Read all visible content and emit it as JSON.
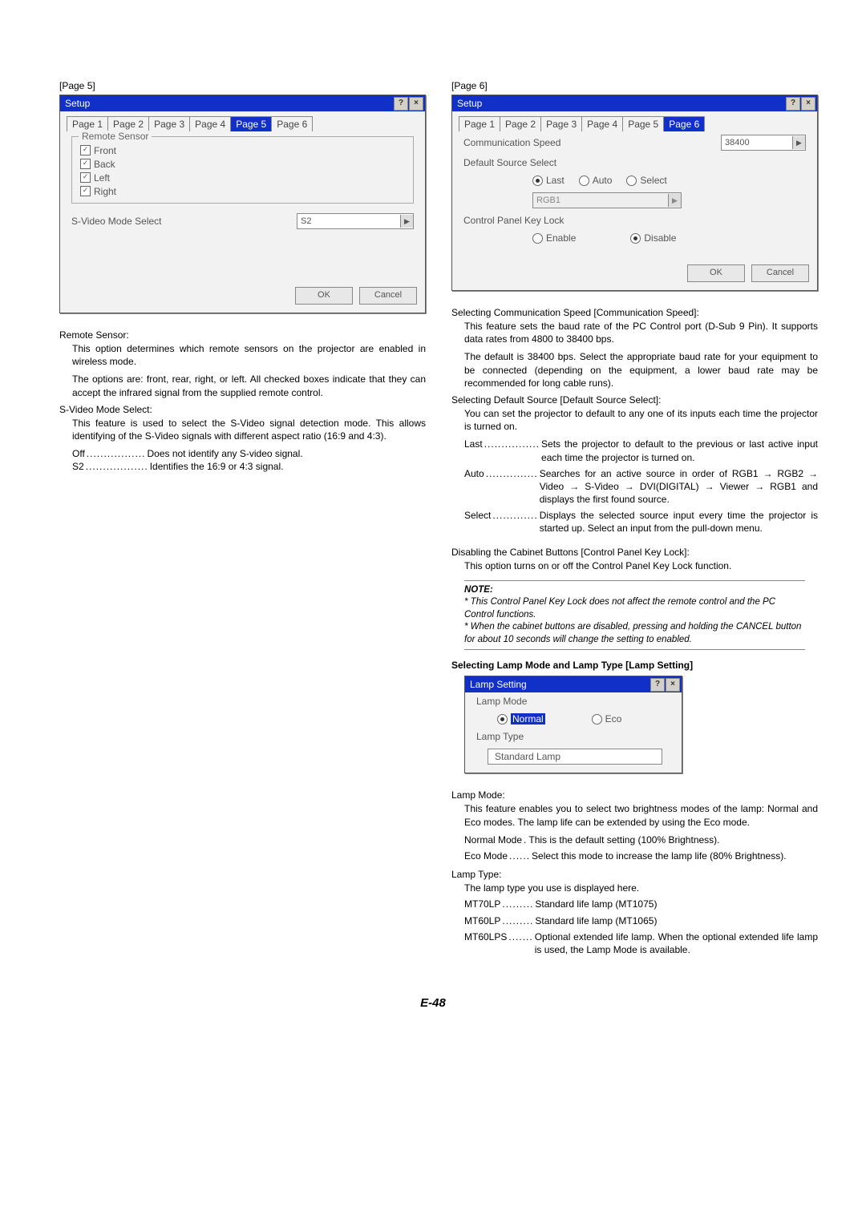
{
  "left": {
    "pageLabel": "[Page 5]",
    "dlg": {
      "title": "Setup",
      "tabs": [
        "Page 1",
        "Page 2",
        "Page 3",
        "Page 4",
        "Page 5",
        "Page 6"
      ],
      "activeTab": 4,
      "group": "Remote Sensor",
      "checks": [
        "Front",
        "Back",
        "Left",
        "Right"
      ],
      "svLabel": "S-Video Mode Select",
      "svValue": "S2",
      "ok": "OK",
      "cancel": "Cancel"
    },
    "remoteHead": "Remote Sensor:",
    "remoteP1": "This option determines which remote sensors on the projector are enabled in wireless mode.",
    "remoteP2": "The options are: front, rear, right, or left. All checked boxes indicate that they can accept the infrared signal from the supplied remote control.",
    "svHead": "S-Video Mode Select:",
    "svP1": "This feature is used to select the S-Video signal detection mode. This allows identifying of the S-Video signals with different aspect ratio (16:9 and 4:3).",
    "svDefs": [
      {
        "k": "Off",
        "dots": " .................",
        "v": "Does not identify any S-video signal."
      },
      {
        "k": "S2",
        "dots": " ..................",
        "v": "Identifies the 16:9 or 4:3 signal."
      }
    ]
  },
  "right": {
    "pageLabel": "[Page 6]",
    "dlg": {
      "title": "Setup",
      "tabs": [
        "Page 1",
        "Page 2",
        "Page 3",
        "Page 4",
        "Page 5",
        "Page 6"
      ],
      "activeTab": 5,
      "commLabel": "Communication Speed",
      "commValue": "38400",
      "defSrcLabel": "Default Source Select",
      "radios": [
        "Last",
        "Auto",
        "Select"
      ],
      "radioSel": 0,
      "srcValue": "RGB1",
      "cplkLabel": "Control Panel Key Lock",
      "cplkRadios": [
        "Enable",
        "Disable"
      ],
      "cplkSel": 1,
      "ok": "OK",
      "cancel": "Cancel"
    },
    "commHead": "Selecting Communication Speed [Communication Speed]:",
    "commP1": "This feature sets the baud rate of the PC Control port (D-Sub 9 Pin). It supports data rates from 4800 to 38400 bps.",
    "commP2": "The default is 38400 bps. Select the appropriate baud rate for your equipment to be connected (depending on the equipment, a lower baud rate may be recommended for long cable runs).",
    "defHead": "Selecting Default Source [Default Source Select]:",
    "defP1": "You can set the projector to default to any one of its inputs each time the projector is turned on.",
    "defDefs": [
      {
        "k": "Last",
        "dots": " ................",
        "v": "Sets the projector to default to the previous or last active input each time the projector is turned on."
      },
      {
        "k": "Auto",
        "dots": " ...............",
        "v": "Searches for an active source in order of RGB1 → RGB2 → Video → S-Video → DVI(DIGITAL) → Viewer → RGB1 and displays the first found source."
      },
      {
        "k": "Select",
        "dots": " .............",
        "v": "Displays the selected source input every time the projector is started up. Select an input from the pull-down menu."
      }
    ],
    "cplkHead": "Disabling the Cabinet Buttons [Control Panel Key Lock]:",
    "cplkP1": "This option turns on or off the Control Panel Key Lock function.",
    "note": {
      "head": "NOTE:",
      "n1": "* This Control Panel Key Lock does not affect the remote control and the PC Control functions.",
      "n2": "* When the cabinet buttons are disabled, pressing and holding the CANCEL button for about 10 seconds will change the setting to enabled."
    },
    "lampHead": "Selecting Lamp Mode and Lamp Type [Lamp Setting]",
    "lampDlg": {
      "title": "Lamp Setting",
      "modeLabel": "Lamp Mode",
      "modeRadios": [
        "Normal",
        "Eco"
      ],
      "modeSel": 0,
      "typeLabel": "Lamp Type",
      "typeValue": "Standard Lamp"
    },
    "lmHead": "Lamp Mode:",
    "lmP1": "This feature enables you to select two brightness modes of the lamp: Normal and Eco modes. The lamp life can be extended by using the Eco mode.",
    "lmDefs": [
      {
        "k": "Normal Mode",
        "dots": " .",
        "v": "This is the default setting (100% Brightness)."
      },
      {
        "k": "Eco Mode",
        "dots": "  ......",
        "v": "Select this mode to increase the lamp life (80% Brightness)."
      }
    ],
    "ltHead": "Lamp Type:",
    "ltP1": "The lamp type you use is displayed here.",
    "ltDefs": [
      {
        "k": "MT70LP",
        "dots": " .........",
        "v": "Standard life lamp (MT1075)"
      },
      {
        "k": "MT60LP",
        "dots": " .........",
        "v": "Standard life lamp (MT1065)"
      },
      {
        "k": "MT60LPS",
        "dots": " .......",
        "v": "Optional extended life lamp. When the optional extended life lamp is used, the Lamp Mode is available."
      }
    ]
  },
  "foot": "E-48"
}
